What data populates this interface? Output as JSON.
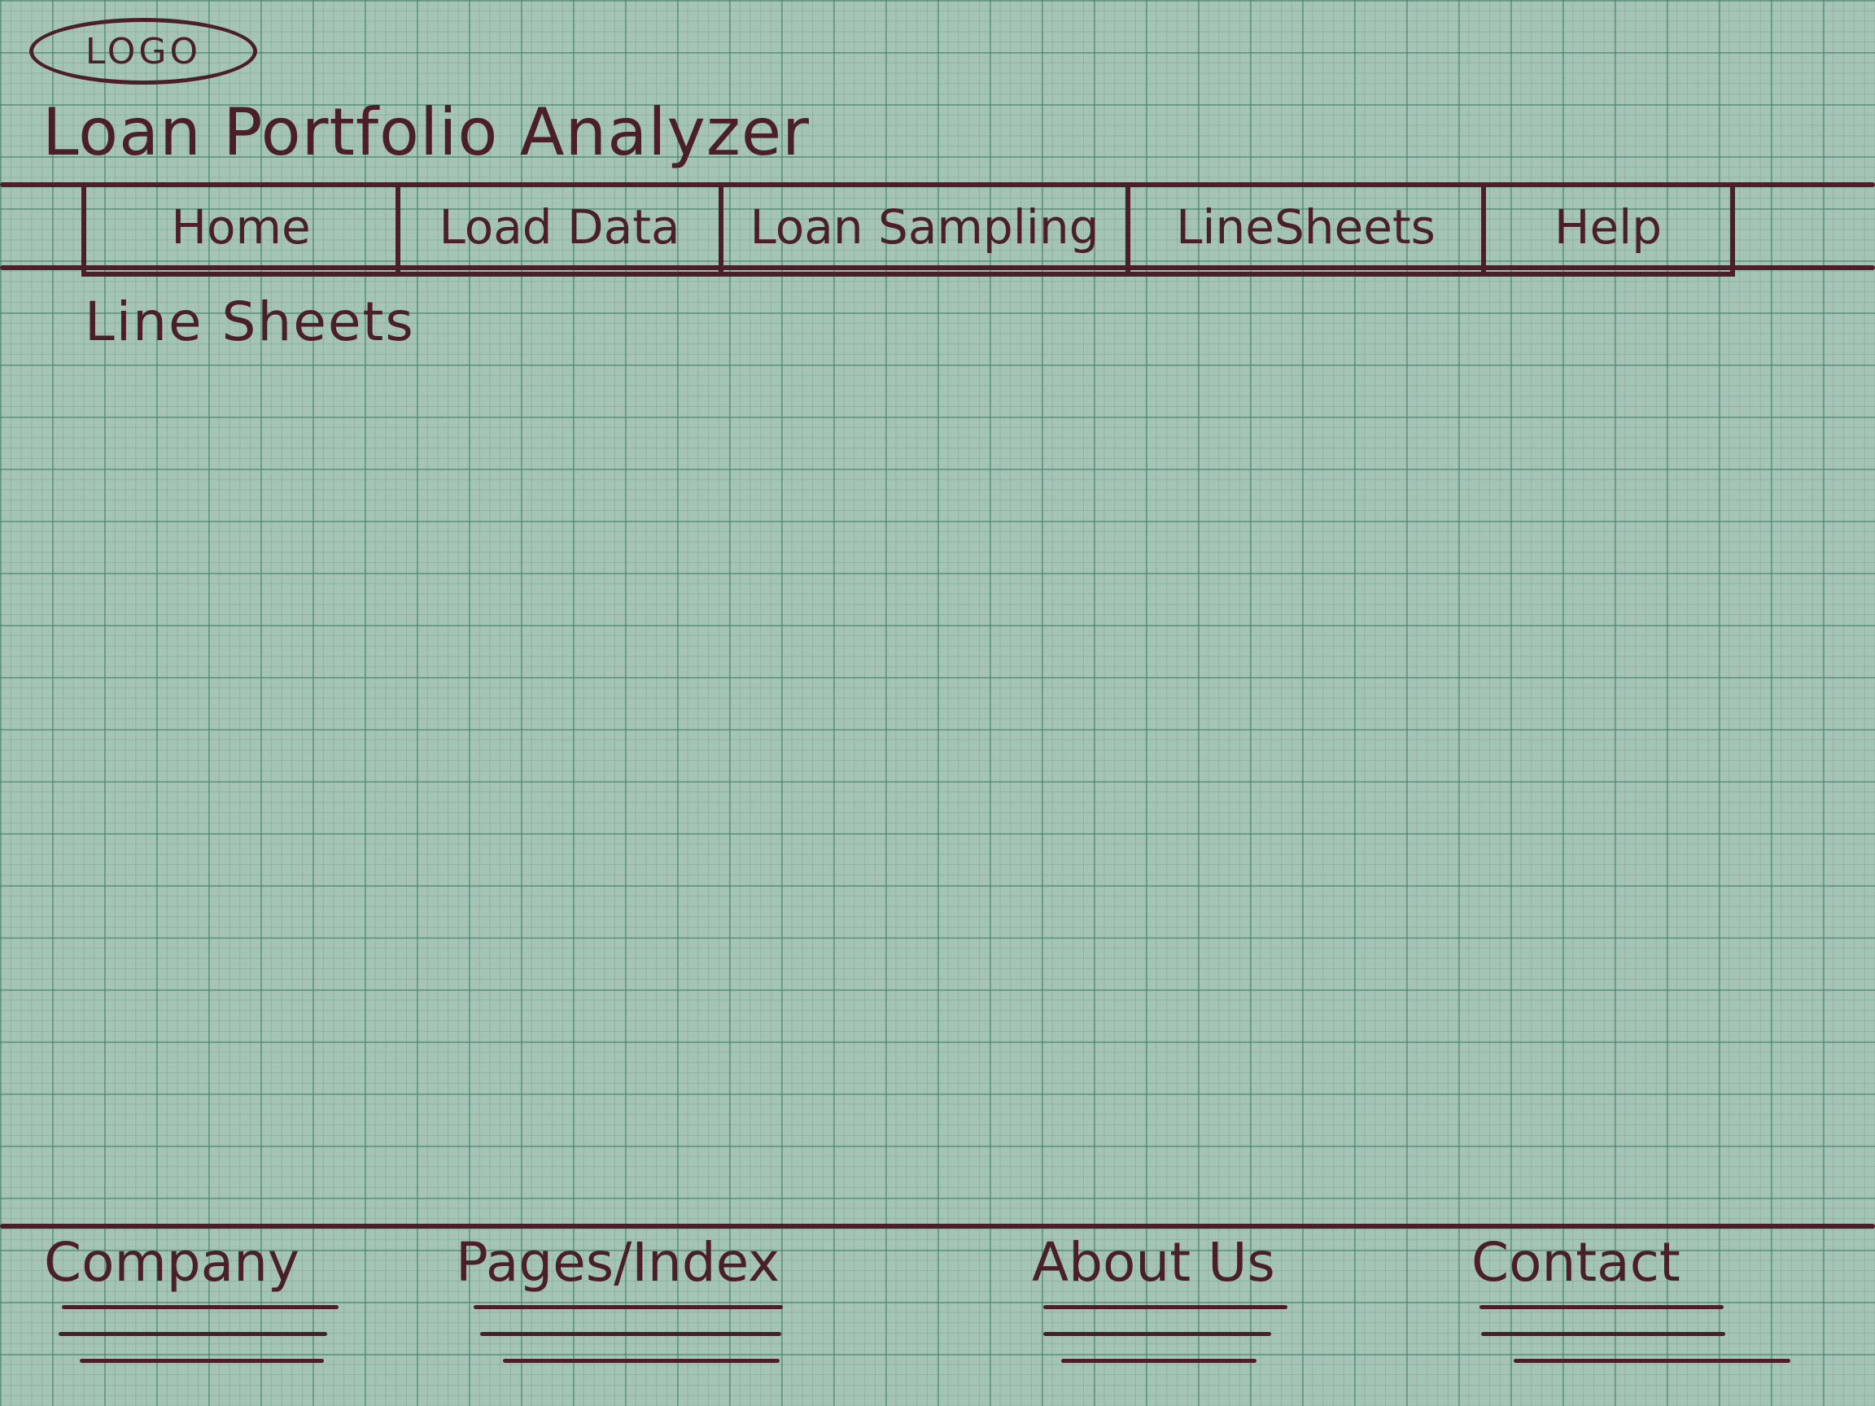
{
  "logo": {
    "text": "LOGO"
  },
  "header": {
    "app_title": "Loan Portfolio Analyzer"
  },
  "nav": {
    "tabs": [
      {
        "label": "Home"
      },
      {
        "label": "Load Data"
      },
      {
        "label": "Loan Sampling"
      },
      {
        "label": "LineSheets"
      },
      {
        "label": "Help"
      }
    ]
  },
  "main": {
    "page_title": "Line Sheets"
  },
  "footer": {
    "columns": [
      {
        "heading": "Company"
      },
      {
        "heading": "Pages/Index"
      },
      {
        "heading": "About Us"
      },
      {
        "heading": "Contact"
      }
    ]
  },
  "colors": {
    "paper": "#a5c4b5",
    "grid": "#46826e",
    "ink": "#4a1f28"
  }
}
